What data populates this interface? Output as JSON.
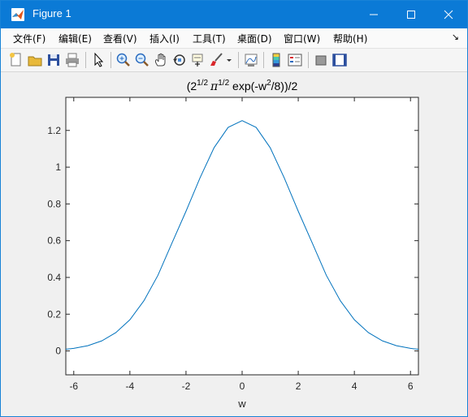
{
  "window": {
    "title": "Figure 1",
    "icon": "matlab-icon",
    "controls": [
      "minimize-icon",
      "maximize-icon",
      "close-icon"
    ]
  },
  "menubar": {
    "items": [
      {
        "label": "文件(F)",
        "name": "menu-file"
      },
      {
        "label": "编辑(E)",
        "name": "menu-edit"
      },
      {
        "label": "查看(V)",
        "name": "menu-view"
      },
      {
        "label": "插入(I)",
        "name": "menu-insert"
      },
      {
        "label": "工具(T)",
        "name": "menu-tools"
      },
      {
        "label": "桌面(D)",
        "name": "menu-desktop"
      },
      {
        "label": "窗口(W)",
        "name": "menu-window"
      },
      {
        "label": "帮助(H)",
        "name": "menu-help"
      }
    ],
    "overflow_icon": "dock-arrow-icon"
  },
  "toolbar": {
    "icons": [
      "new-figure-icon",
      "open-file-icon",
      "save-icon",
      "print-icon",
      "select-arrow-icon",
      "zoom-in-icon",
      "zoom-out-icon",
      "pan-hand-icon",
      "rotate-3d-icon",
      "data-cursor-icon",
      "brush-icon",
      "brush-dropdown-icon",
      "link-plot-icon",
      "insert-colorbar-icon",
      "insert-legend-icon",
      "hide-plot-tools-icon",
      "show-plot-tools-icon"
    ]
  },
  "colors": {
    "titlebar": "#0b7ad6",
    "line": "#0072bd",
    "axes_bg": "#ffffff",
    "figure_bg": "#f0f0f0"
  },
  "chart_data": {
    "type": "line",
    "title_base": "(2",
    "title_sup1": "1/2",
    "title_pi": "π",
    "title_sup2": "1/2",
    "title_mid": " exp(-w",
    "title_sup3": "2",
    "title_end": "/8))/2",
    "xlabel": "w",
    "ylabel": "",
    "xlim": [
      -6.2832,
      6.2832
    ],
    "ylim": [
      -0.13,
      1.38
    ],
    "xticks": [
      -6,
      -4,
      -2,
      0,
      2,
      4,
      6
    ],
    "xtick_labels": [
      "-6",
      "-4",
      "-2",
      "0",
      "2",
      "4",
      "6"
    ],
    "yticks": [
      0,
      0.2,
      0.4,
      0.6,
      0.8,
      1,
      1.2
    ],
    "ytick_labels": [
      "0",
      "0.2",
      "0.4",
      "0.6",
      "0.8",
      "1",
      "1.2"
    ],
    "grid": false,
    "series": [
      {
        "x": [
          -6.2832,
          -6,
          -5.5,
          -5,
          -4.5,
          -4,
          -3.5,
          -3,
          -2.5,
          -2,
          -1.5,
          -1,
          -0.5,
          0,
          0.5,
          1,
          1.5,
          2,
          2.5,
          3,
          3.5,
          4,
          4.5,
          5,
          5.5,
          6,
          6.2832
        ],
        "values": [
          0.0092,
          0.0139,
          0.0286,
          0.0548,
          0.0997,
          0.1696,
          0.273,
          0.4117,
          0.5873,
          0.7602,
          0.9422,
          1.106,
          1.2165,
          1.2533,
          1.2165,
          1.106,
          0.9422,
          0.7602,
          0.5873,
          0.4117,
          0.273,
          0.1696,
          0.0997,
          0.0548,
          0.0286,
          0.0139,
          0.0092
        ]
      }
    ]
  }
}
